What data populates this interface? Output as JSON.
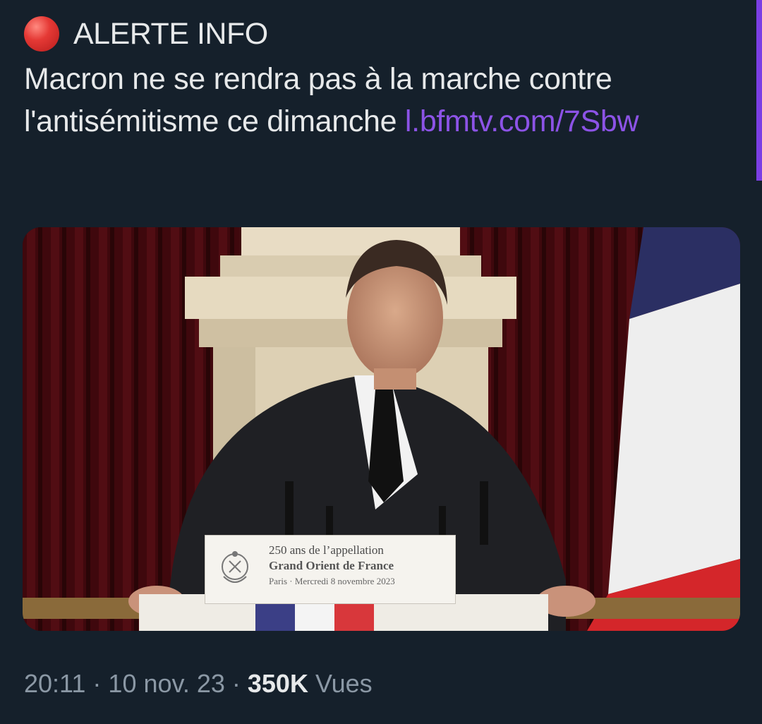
{
  "tweet": {
    "alert_label": "ALERTE INFO",
    "headline_text": "Macron ne se rendra pas à la marche contre l'antisémitisme ce dimanche ",
    "link_text": "l.bfmtv.com/7Sbw",
    "link_color": "#8c53e6",
    "status_icon": "red-circle-icon"
  },
  "media": {
    "placard": {
      "line1": "250 ans de l’appellation",
      "line2": "Grand Orient de France",
      "line3": "Paris · Mercredi 8 novembre 2023"
    }
  },
  "meta": {
    "time": "20:11",
    "separator": "·",
    "date": "10 nov. 23",
    "views_count": "350K",
    "views_label": "Vues"
  },
  "colors": {
    "background": "#15202b",
    "text": "#e7e9ea",
    "muted": "#8b98a5",
    "accent": "#7b3fe4"
  }
}
